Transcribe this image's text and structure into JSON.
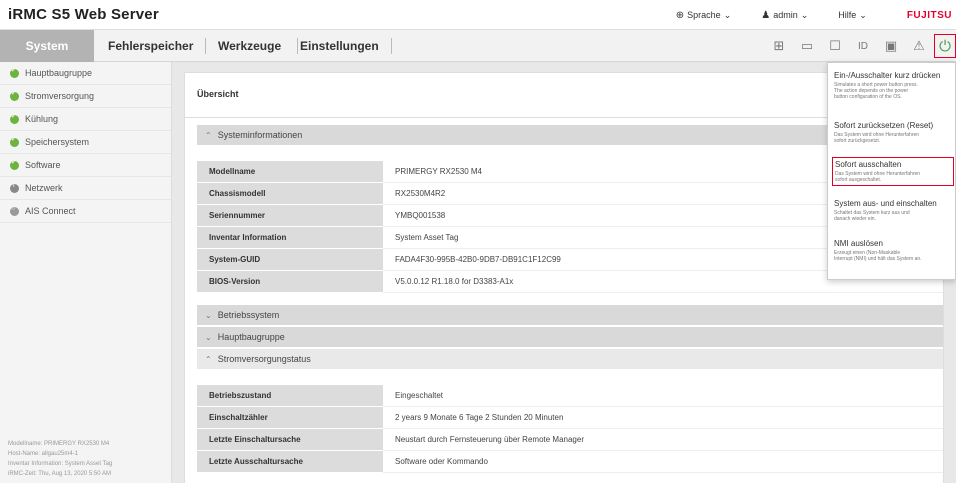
{
  "app": {
    "title": "iRMC S5 Web Server"
  },
  "top": {
    "language": "Sprache",
    "user": "admin",
    "help": "Hilfe",
    "brand": "FUJITSU"
  },
  "nav": {
    "tabs": [
      "System",
      "Fehlerspeicher",
      "Werkzeuge",
      "Einstellungen"
    ]
  },
  "sidebar": {
    "items": [
      "Hauptbaugruppe",
      "Stromversorgung",
      "Kühlung",
      "Speichersystem",
      "Software",
      "Netzwerk",
      "AIS Connect"
    ],
    "footer": [
      "Modellname: PRIMERGY RX2530 M4",
      "Host-Name: allgau25m4-1",
      "Inventar Information: System Asset Tag",
      "iRMC-Zeit: Thu, Aug 13, 2020 5:50 AM"
    ]
  },
  "main": {
    "title": "Übersicht",
    "sections": {
      "sysinfo": "Systeminformationen",
      "os": "Betriebssystem",
      "mainboard": "Hauptbaugruppe",
      "power": "Stromversorgungstatus"
    },
    "sysinfo_rows": [
      {
        "key": "Modellname",
        "value": "PRIMERGY RX2530 M4"
      },
      {
        "key": "Chassismodell",
        "value": "RX2530M4R2"
      },
      {
        "key": "Seriennummer",
        "value": "YMBQ001538"
      },
      {
        "key": "Inventar Information",
        "value": "System Asset Tag"
      },
      {
        "key": "System-GUID",
        "value": "FADA4F30-995B-42B0-9DB7-DB91C1F12C99"
      },
      {
        "key": "BIOS-Version",
        "value": "V5.0.0.12 R1.18.0 for D3383-A1x"
      }
    ],
    "power_rows": [
      {
        "key": "Betriebszustand",
        "value": "Eingeschaltet"
      },
      {
        "key": "Einschaltzähler",
        "value": "2 years 9 Monate 6 Tage 2 Stunden 20 Minuten"
      },
      {
        "key": "Letzte Einschaltursache",
        "value": "Neustart durch Fernsteuerung über Remote Manager"
      },
      {
        "key": "Letzte Ausschaltursache",
        "value": "Software oder Kommando"
      }
    ]
  },
  "power_menu": [
    {
      "title": "Ein-/Ausschalter kurz drücken",
      "desc": [
        "Simulates a short power button press.",
        "The action depends on the power",
        "button configuration of the OS."
      ]
    },
    {
      "title": "Sofort zurücksetzen (Reset)",
      "desc": [
        "Das System wird ohne Herunterfahren",
        "sofort zurückgesetzt."
      ]
    },
    {
      "title": "Sofort ausschalten",
      "desc": [
        "Das System wird ohne Herunterfahren",
        "sofort ausgeschaltet."
      ]
    },
    {
      "title": "System aus- und einschalten",
      "desc": [
        "Schaltet das System kurz aus und",
        "danach wieder ein."
      ]
    },
    {
      "title": "NMI auslösen",
      "desc": [
        "Erzeugt einen (Non-Maskable",
        "Interrupt (NMI) und hält das System an."
      ]
    }
  ],
  "colors": {
    "accent_red": "#e30022",
    "ok_green": "#6cb33f",
    "nav_active": "#b3b3b3"
  }
}
